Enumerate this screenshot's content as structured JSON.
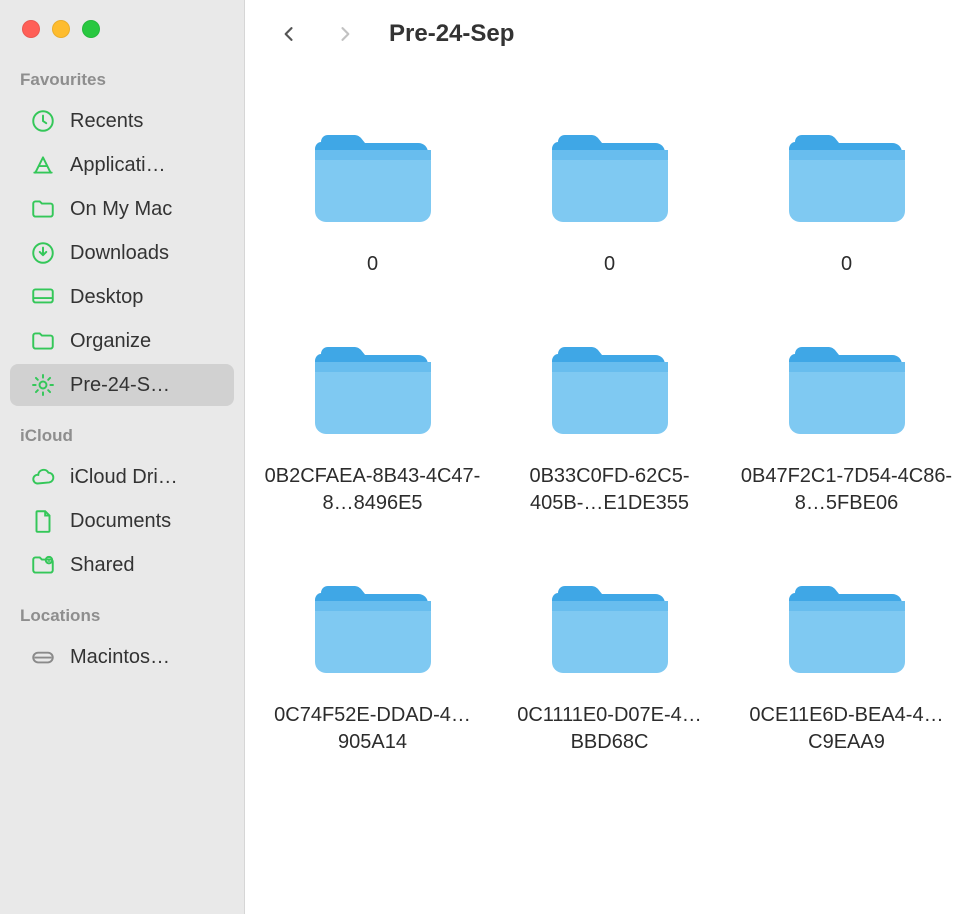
{
  "window": {
    "title": "Pre-24-Sep"
  },
  "sidebar": {
    "sections": [
      {
        "label": "Favourites",
        "items": [
          {
            "icon": "clock-icon",
            "label": "Recents",
            "selected": false
          },
          {
            "icon": "applications-icon",
            "label": "Applicati…",
            "selected": false
          },
          {
            "icon": "folder-outline-icon",
            "label": "On My Mac",
            "selected": false
          },
          {
            "icon": "download-circle-icon",
            "label": "Downloads",
            "selected": false
          },
          {
            "icon": "desktop-icon",
            "label": "Desktop",
            "selected": false
          },
          {
            "icon": "folder-outline-icon",
            "label": "Organize",
            "selected": false
          },
          {
            "icon": "gear-icon",
            "label": "Pre-24-S…",
            "selected": true
          }
        ]
      },
      {
        "label": "iCloud",
        "items": [
          {
            "icon": "cloud-icon",
            "label": "iCloud Dri…",
            "selected": false
          },
          {
            "icon": "document-icon",
            "label": "Documents",
            "selected": false
          },
          {
            "icon": "shared-folder-icon",
            "label": "Shared",
            "selected": false
          }
        ]
      },
      {
        "label": "Locations",
        "items": [
          {
            "icon": "disk-icon",
            "label": "Macintos…",
            "selected": false
          }
        ]
      }
    ]
  },
  "folders": [
    {
      "label": "0"
    },
    {
      "label": "0"
    },
    {
      "label": "0"
    },
    {
      "label": "0B2CFAEA-8B43-4C47-8…8496E5"
    },
    {
      "label": "0B33C0FD-62C5-405B-…E1DE355"
    },
    {
      "label": "0B47F2C1-7D54-4C86-8…5FBE06"
    },
    {
      "label": "0C74F52E-DDAD-4…905A14"
    },
    {
      "label": "0C1111E0-D07E-4…BBD68C"
    },
    {
      "label": "0CE11E6D-BEA4-4…C9EAA9"
    }
  ]
}
